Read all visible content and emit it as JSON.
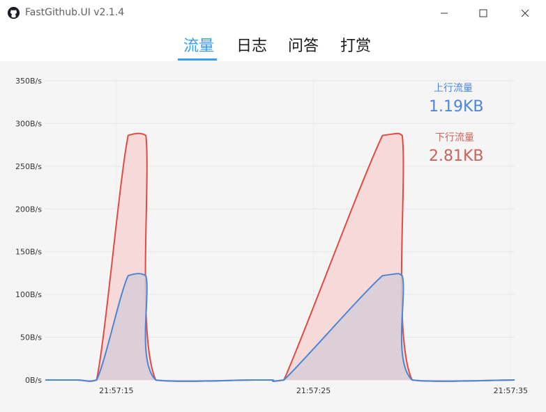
{
  "window": {
    "title": "FastGithub.UI v2.1.4",
    "minimize_glyph": "—",
    "maximize_glyph": "☐",
    "close_glyph": "✕"
  },
  "tabs": [
    {
      "label": "流量",
      "active": true
    },
    {
      "label": "日志",
      "active": false
    },
    {
      "label": "问答",
      "active": false
    },
    {
      "label": "打赏",
      "active": false
    }
  ],
  "legend": {
    "upload_label": "上行流量",
    "upload_total": "1.19KB",
    "download_label": "下行流量",
    "download_total": "2.81KB"
  },
  "colors": {
    "accent": "#3b9df0",
    "upload_line": "#4a86d6",
    "download_line": "#e04a42",
    "download_fill": "#f6d6d6",
    "upload_fill": "#d8ccd6"
  },
  "chart_data": {
    "type": "area",
    "ylim": [
      0,
      350
    ],
    "y_ticks": [
      "0B/s",
      "50B/s",
      "100B/s",
      "150B/s",
      "200B/s",
      "250B/s",
      "300B/s",
      "350B/s"
    ],
    "x_ticks": [
      "21:57:15",
      "21:57:25",
      "21:57:35"
    ],
    "xlim": [
      "21:57:11.4",
      "21:57:35.2"
    ],
    "series": [
      {
        "name": "下行流量",
        "x": [
          "21:57:11.4",
          "21:57:13.0",
          "21:57:14.0",
          "21:57:15.6",
          "21:57:16.5",
          "21:57:17.0",
          "21:57:22.0",
          "21:57:22.9",
          "21:57:23.5",
          "21:57:28.5",
          "21:57:29.5",
          "21:57:30.0",
          "21:57:35.2"
        ],
        "values": [
          0,
          0,
          0,
          286,
          286,
          0,
          0,
          0,
          0,
          286,
          286,
          0,
          0
        ]
      },
      {
        "name": "上行流量",
        "x": [
          "21:57:11.4",
          "21:57:13.0",
          "21:57:14.0",
          "21:57:15.6",
          "21:57:16.5",
          "21:57:17.0",
          "21:57:22.0",
          "21:57:22.9",
          "21:57:23.5",
          "21:57:28.5",
          "21:57:29.5",
          "21:57:30.0",
          "21:57:35.2"
        ],
        "values": [
          0,
          0,
          0,
          122,
          122,
          0,
          0,
          0,
          0,
          122,
          122,
          0,
          0
        ]
      }
    ]
  }
}
